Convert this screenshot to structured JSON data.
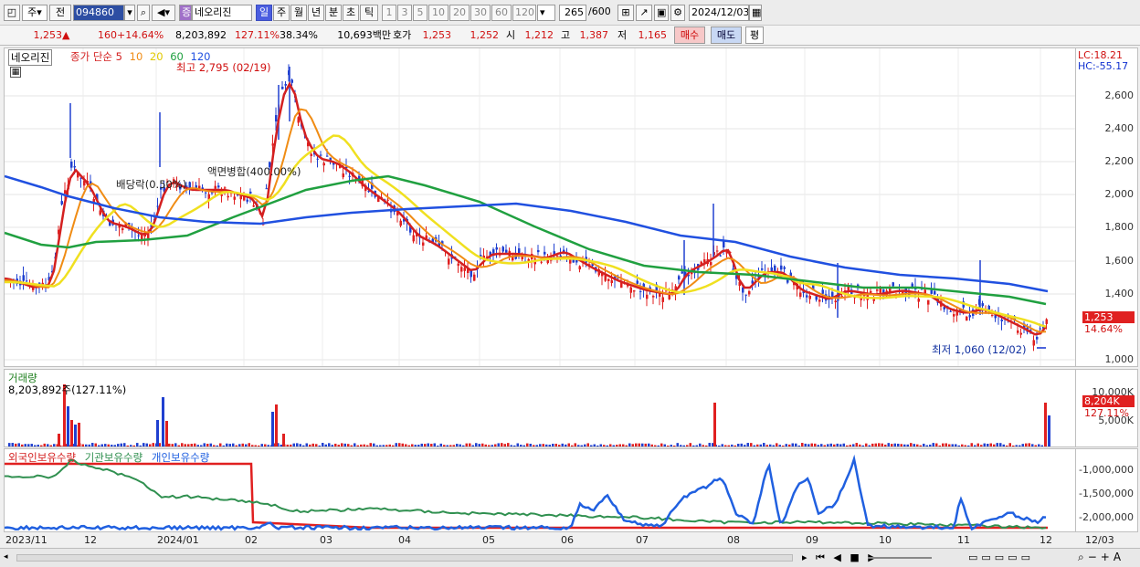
{
  "toolbar": {
    "period_type": "주",
    "prev_label": "전",
    "stock_code": "094860",
    "market_badge": "증",
    "stock_name": "네오리진",
    "periods": [
      "일",
      "주",
      "월",
      "년",
      "분",
      "초",
      "틱"
    ],
    "active_period": "일",
    "intervals": [
      "1",
      "3",
      "5",
      "10",
      "20",
      "30",
      "60",
      "120"
    ],
    "count_value": "265",
    "count_total": "/600",
    "date": "2024/12/03"
  },
  "quote": {
    "price": "1,253",
    "change_arrow": "▲",
    "change": "160",
    "change_pct": "+14.64%",
    "volume": "8,203,892",
    "volume_ratio": "127.11%",
    "turnover": "38.34%",
    "amount": "10,693백만",
    "bid_label": "호가",
    "ask": "1,253",
    "bid": "1,252",
    "open_label": "시",
    "open": "1,212",
    "high_label": "고",
    "high": "1,387",
    "low_label": "저",
    "low": "1,165",
    "buy_button": "매수",
    "sell_button": "매도",
    "eval_button": "평"
  },
  "price_panel": {
    "stock_label": "네오리진",
    "ma_label": "종가 단순",
    "ma_periods": [
      "5",
      "10",
      "20",
      "60",
      "120"
    ],
    "ma_colors": [
      "#d42020",
      "#f08c14",
      "#f0e020",
      "#20a040",
      "#2050e0"
    ],
    "lc": "LC:18.21",
    "hc": "HC:-55.17",
    "y_ticks": [
      "2,600",
      "2,400",
      "2,200",
      "2,000",
      "1,800",
      "1,600",
      "1,400",
      "1,000"
    ],
    "price_tag": "1,253",
    "pct_tag": "14.64%",
    "annotations": {
      "high": "최고 2,795 (02/19)",
      "low": "최저 1,060 (12/02)",
      "dividend": "배당락(0.50%)",
      "merge": "액면병합(400.00%)"
    }
  },
  "volume_panel": {
    "title": "거래량",
    "value": "8,203,892주(127.11%)",
    "y_tick": "10,000K",
    "y_tick2": "5,000K",
    "vol_tag": "8,204K",
    "ratio_tag": "127.11%"
  },
  "holdings_panel": {
    "series": [
      "외국인보유수량",
      "기관보유수량",
      "개인보유수량"
    ],
    "colors": [
      "#d42020",
      "#309050",
      "#2060e0"
    ],
    "y_ticks": [
      "-1,000,000",
      "-1,500,000",
      "-2,000,000"
    ]
  },
  "x_axis": {
    "labels": [
      "2023/11",
      "12",
      "2024/01",
      "02",
      "03",
      "04",
      "05",
      "06",
      "07",
      "08",
      "09",
      "10",
      "11",
      "12"
    ],
    "right_label": "12/03"
  }
}
